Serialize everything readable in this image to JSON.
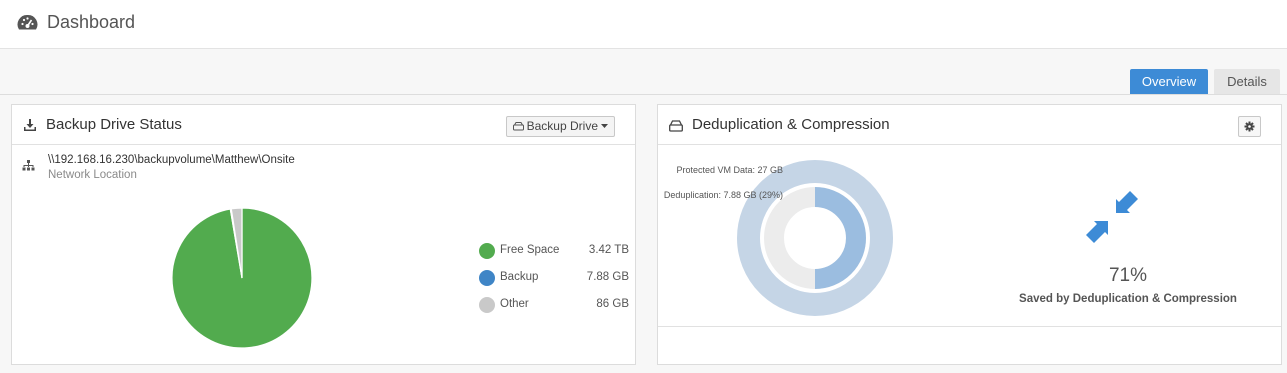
{
  "header": {
    "title": "Dashboard",
    "icon": "dashboard-icon"
  },
  "tabs": [
    {
      "label": "Overview",
      "active": true
    },
    {
      "label": "Details",
      "active": false
    }
  ],
  "backup_panel": {
    "title": "Backup Drive Status",
    "icon": "download-icon",
    "dropdown_label": "Backup Drive",
    "network_path": "\\\\192.168.16.230\\backupvolume\\Matthew\\Onsite",
    "network_sub": "Network Location",
    "legend": [
      {
        "label": "Free Space",
        "value": "3.42 TB",
        "color": "#52ab4e"
      },
      {
        "label": "Backup",
        "value": "7.88 GB",
        "color": "#3f85c6"
      },
      {
        "label": "Other",
        "value": "86 GB",
        "color": "#c9c9c9"
      }
    ]
  },
  "dedup_panel": {
    "title": "Deduplication & Compression",
    "icon": "hard-drive-icon",
    "protected_label": "Protected VM Data: 27 GB",
    "dedup_label": "Deduplication: 7.88 GB (29%)",
    "percent": "71%",
    "saved_label": "Saved by Deduplication & Compression",
    "colors": {
      "outer": "#c5d5e6",
      "inner": "#9bbde0",
      "inner_track": "#ececec",
      "arrows": "#3d8bd6"
    }
  },
  "chart_data": [
    {
      "type": "pie",
      "categories": [
        "Free Space",
        "Backup",
        "Other"
      ],
      "values": [
        3420,
        7.88,
        86
      ],
      "units": "GB"
    },
    {
      "type": "ring",
      "series": [
        {
          "name": "Protected VM Data",
          "value": 27
        },
        {
          "name": "Deduplication",
          "value": 7.88,
          "percent": 29
        }
      ],
      "saved_percent": 71
    }
  ]
}
